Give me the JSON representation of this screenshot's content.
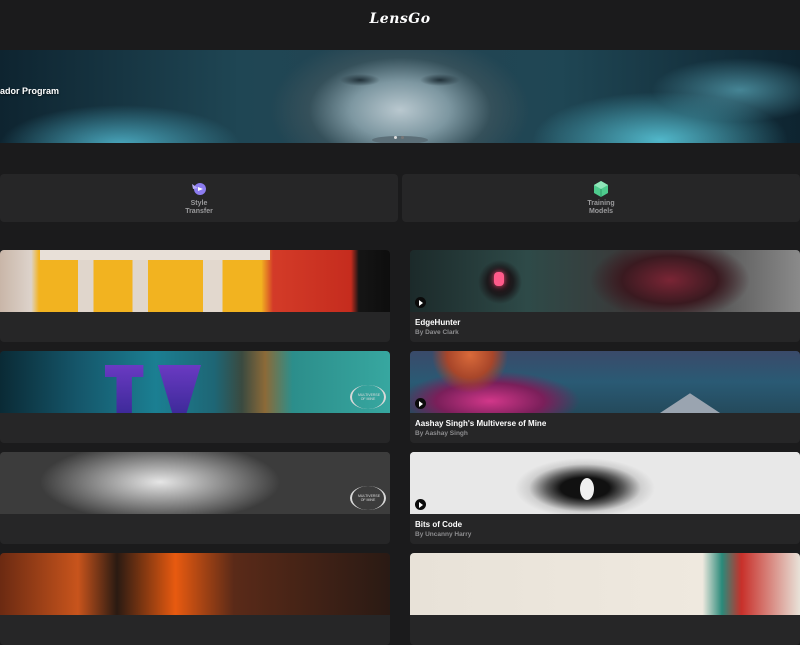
{
  "app": {
    "logo": "LensGo"
  },
  "banner": {
    "label": "ador Program"
  },
  "features": [
    {
      "icon": "style-transfer-icon",
      "label": "Style Transfer",
      "color": "#8c7cf0"
    },
    {
      "icon": "training-models-icon",
      "label": "Training Models",
      "color": "#4ecb8d"
    }
  ],
  "videos_left": [
    {
      "title": "",
      "author": ""
    },
    {
      "title": "",
      "author": "",
      "laurel": "MULTIVERSE OF MINE"
    },
    {
      "title": "",
      "author": "",
      "laurel": "MULTIVERSE OF MINE"
    },
    {
      "title": "",
      "author": ""
    }
  ],
  "videos_right": [
    {
      "title": "EdgeHunter",
      "author": "By Dave Clark"
    },
    {
      "title": "Aashay Singh's Multiverse of Mine",
      "author": "By Aashay Singh"
    },
    {
      "title": "Bits of Code",
      "author": "By Uncanny Harry"
    },
    {
      "title": "",
      "author": ""
    }
  ]
}
